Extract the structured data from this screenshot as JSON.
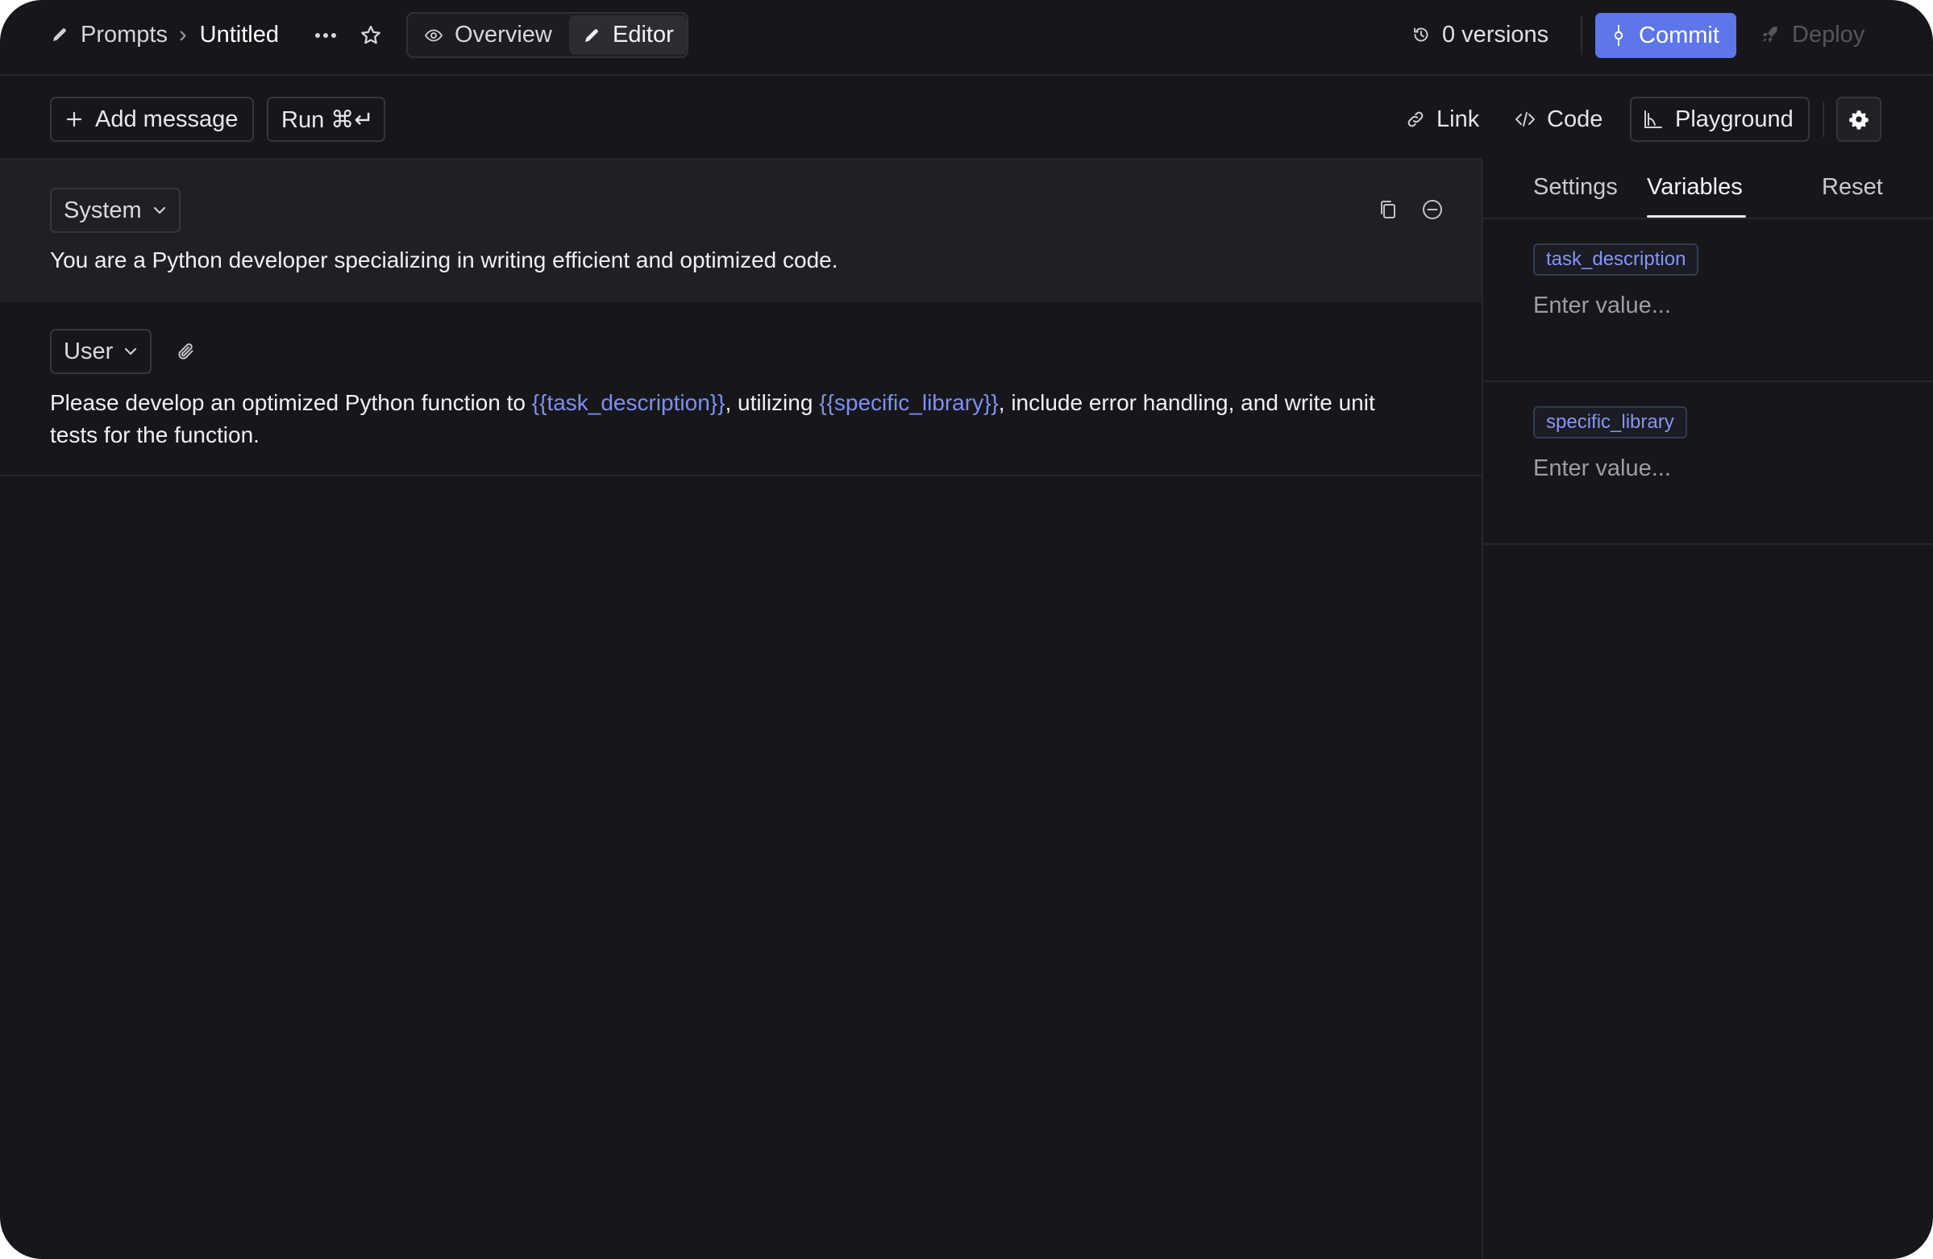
{
  "breadcrumb": {
    "root": "Prompts",
    "separator": "›",
    "current": "Untitled"
  },
  "view_tabs": [
    {
      "label": "Overview",
      "icon": "eye-icon",
      "active": false
    },
    {
      "label": "Editor",
      "icon": "pencil-icon",
      "active": true
    }
  ],
  "header": {
    "versions_label": "0 versions",
    "commit_label": "Commit",
    "deploy_label": "Deploy"
  },
  "toolbar": {
    "add_message_label": "Add message",
    "run_label": "Run ⌘↵",
    "link_label": "Link",
    "code_label": "Code",
    "playground_label": "Playground"
  },
  "messages": [
    {
      "role": "System",
      "text": "You are a Python developer specializing in writing efficient and optimized code."
    },
    {
      "role": "User",
      "text_parts": [
        "Please develop an optimized Python function to ",
        "{{task_description}}",
        ", utilizing ",
        "{{specific_library}}",
        ", include error handling, and write unit",
        "tests for the function."
      ]
    }
  ],
  "right_panel": {
    "tabs": [
      {
        "label": "Settings",
        "active": false
      },
      {
        "label": "Variables",
        "active": true
      }
    ],
    "reset_label": "Reset",
    "variables": [
      {
        "name": "task_description",
        "value": "",
        "placeholder": "Enter value..."
      },
      {
        "name": "specific_library",
        "value": "",
        "placeholder": "Enter value..."
      }
    ]
  },
  "colors": {
    "background": "#17171b",
    "system_block": "#1f1f24",
    "accent": "#5d76ea",
    "variable": "#7d8ff2"
  }
}
